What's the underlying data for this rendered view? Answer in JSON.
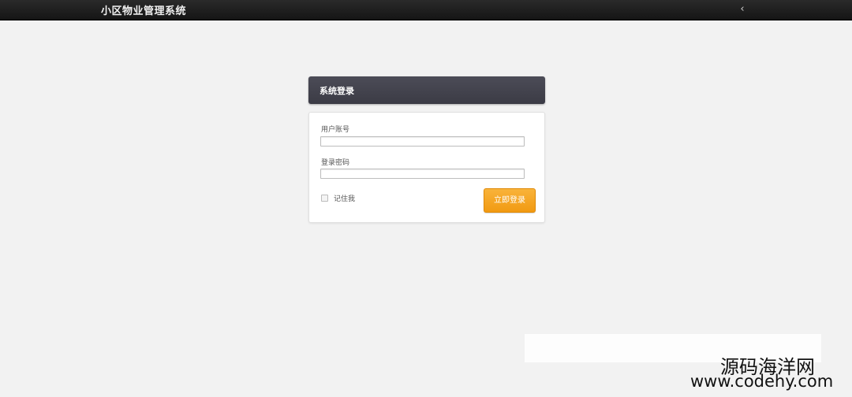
{
  "app": {
    "title": "小区物业管理系统",
    "collapse_glyph": "‹"
  },
  "login": {
    "header_title": "系统登录",
    "username_label": "用户账号",
    "username_value": "",
    "password_label": "登录密码",
    "password_value": "",
    "remember_label": "记住我",
    "remember_checked": false,
    "submit_label": "立即登录"
  },
  "watermark": {
    "line1": "源码海洋网",
    "line2": "www.codehy.com"
  },
  "colors": {
    "topbar": "#1e1e1e",
    "header": "#44444e",
    "button": "#f5a623",
    "background": "#f2f2f2"
  }
}
